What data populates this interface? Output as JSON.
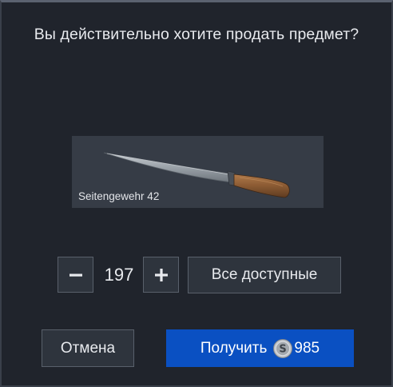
{
  "dialog": {
    "title": "Вы действительно хотите продать предмет?"
  },
  "item": {
    "name": "Seitengewehr 42",
    "icon": "knife-image"
  },
  "quantity": {
    "minus_label": "−",
    "value": "197",
    "plus_label": "+",
    "all_label": "Все доступные"
  },
  "actions": {
    "cancel_label": "Отмена",
    "sell_label": "Получить",
    "sell_amount": "985",
    "currency_icon": "silver-coin-icon"
  },
  "colors": {
    "background": "#20242c",
    "button": "#2e343d",
    "primary": "#0a50c2",
    "item_card": "#363c46"
  }
}
